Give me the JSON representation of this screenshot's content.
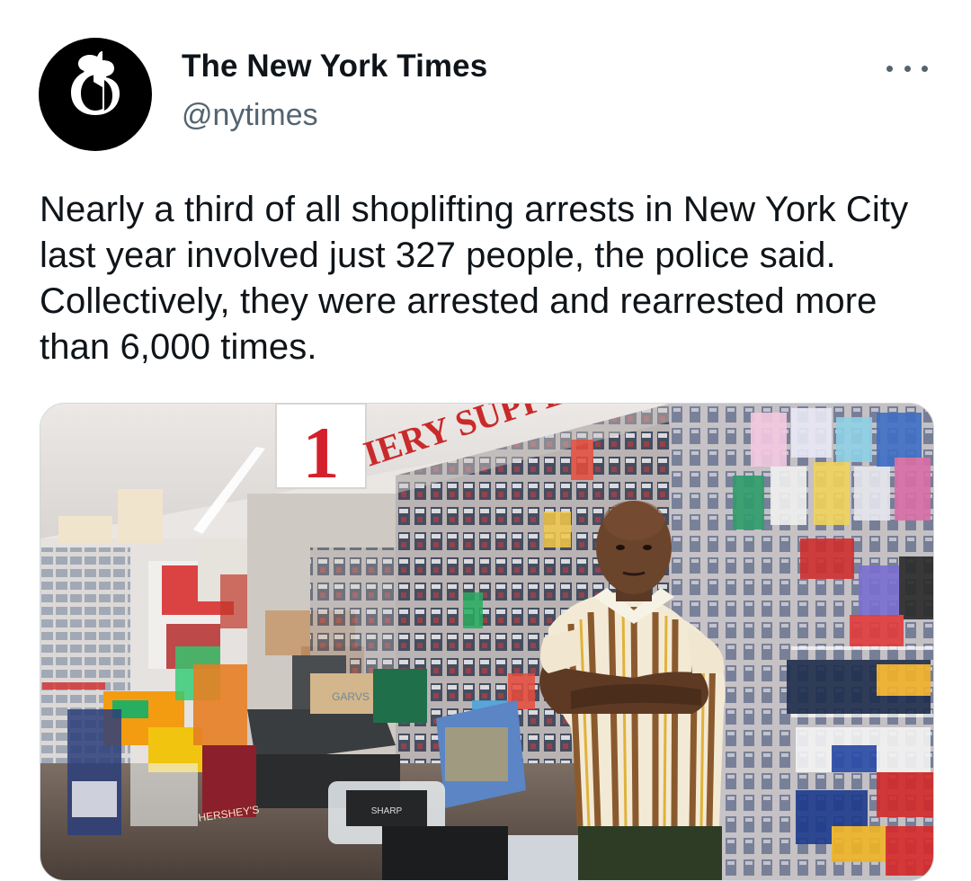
{
  "author": {
    "display_name": "The New York Times",
    "handle": "@nytimes",
    "avatar_icon": "nyt-logo-icon"
  },
  "tweet": {
    "text": "Nearly a third of all shoplifting arrests in New York City last year involved just 327 people, the police said. Collectively, they were arrested and rearrested more than 6,000 times."
  },
  "media": {
    "sign_number": "1",
    "sign_text": "IERY SUPPL",
    "box_label": "GARVS",
    "counter_label": "HERSHEY'S",
    "register_label": "SHARP"
  },
  "colors": {
    "text_primary": "#0f1419",
    "text_secondary": "#536471",
    "border": "#cfd9de",
    "sign_red": "#d4202a"
  }
}
